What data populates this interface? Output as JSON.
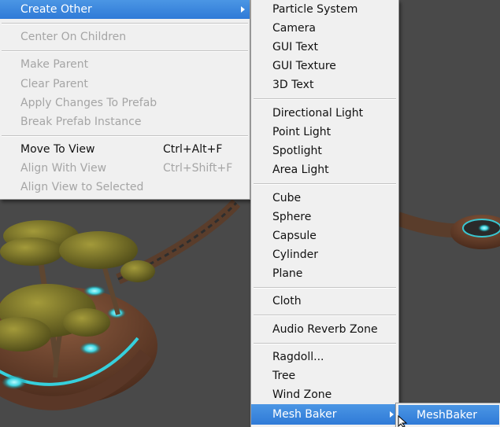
{
  "context_menu": {
    "create_other": "Create Other",
    "center_on_children": "Center On Children",
    "make_parent": "Make Parent",
    "clear_parent": "Clear Parent",
    "apply_changes": "Apply Changes To Prefab",
    "break_prefab": "Break Prefab Instance",
    "move_to_view": "Move To View",
    "move_to_view_shortcut": "Ctrl+Alt+F",
    "align_with_view": "Align With View",
    "align_with_view_shortcut": "Ctrl+Shift+F",
    "align_view_to_selected": "Align View to Selected"
  },
  "create_menu": {
    "items": [
      "Particle System",
      "Camera",
      "GUI Text",
      "GUI Texture",
      "3D Text",
      "Directional Light",
      "Point Light",
      "Spotlight",
      "Area Light",
      "Cube",
      "Sphere",
      "Capsule",
      "Cylinder",
      "Plane",
      "Cloth",
      "Audio Reverb Zone",
      "Ragdoll...",
      "Tree",
      "Wind Zone",
      "Mesh Baker"
    ]
  },
  "meshbaker_menu": {
    "item": "MeshBaker"
  },
  "colors": {
    "menu_background": "#f0f0f0",
    "highlight": "#3a86dc",
    "disabled_text": "#a5a5a5"
  }
}
